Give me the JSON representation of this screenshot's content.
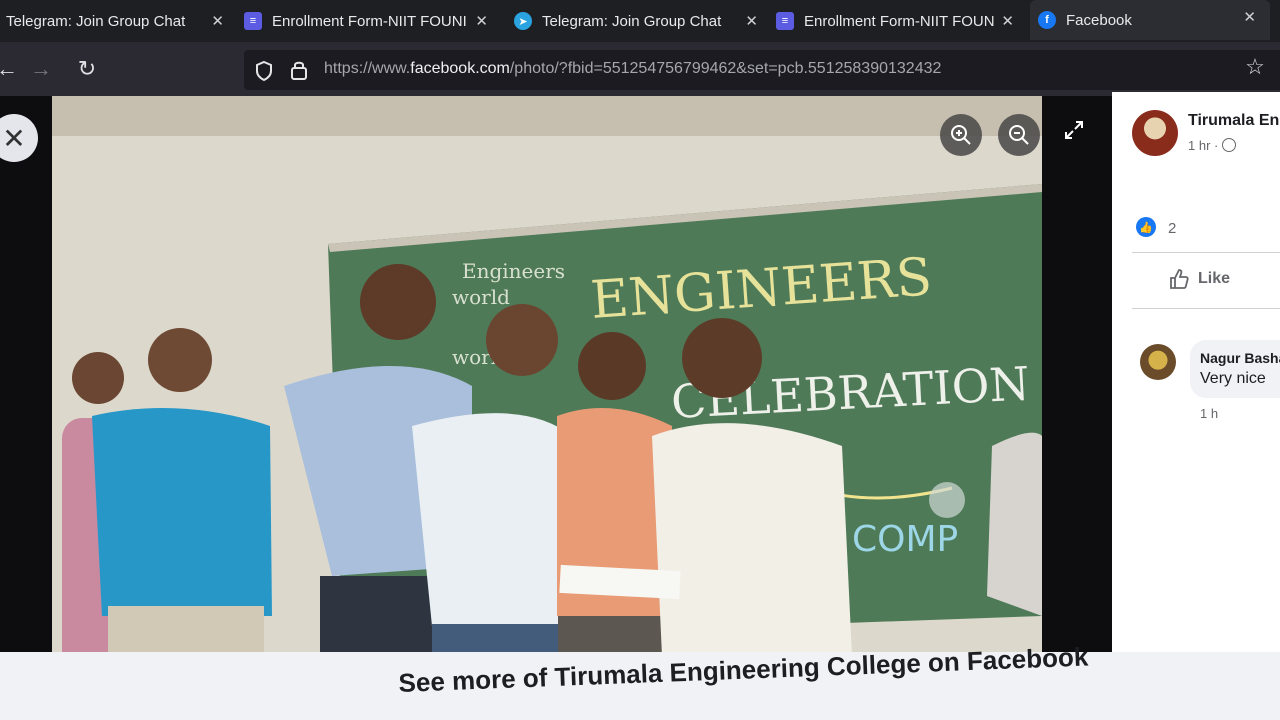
{
  "tabs": [
    {
      "title": "Telegram: Join Group Chat",
      "icon": "telegram-icon"
    },
    {
      "title": "Enrollment Form-NIIT FOUNI",
      "icon": "forms-icon"
    },
    {
      "title": "Telegram: Join Group Chat",
      "icon": "telegram-icon"
    },
    {
      "title": "Enrollment Form-NIIT FOUNI",
      "icon": "forms-icon"
    },
    {
      "title": "Facebook",
      "icon": "facebook-icon",
      "active": true
    }
  ],
  "address_bar": {
    "url_prefix": "https://www.",
    "url_domain": "facebook.com",
    "url_path": "/photo/?fbid=551254756799462&set=pcb.551258390132432"
  },
  "photo": {
    "board_line1": "ENGINEERS",
    "board_line2": "CELEBRATION",
    "board_small": [
      "Engineers",
      "world",
      "world"
    ],
    "board_bottom": "COMP"
  },
  "post": {
    "page_name": "Tirumala En",
    "time": "1 hr ·",
    "reaction_count": "2",
    "like_label": "Like"
  },
  "comment": {
    "author": "Nagur Basha",
    "text": "Very nice",
    "time": "1 h"
  },
  "banner": {
    "text": "See more of Tirumala Engineering College on Facebook"
  },
  "colors": {
    "facebook_blue": "#1877f2",
    "chalkboard": "#4f7a58"
  }
}
